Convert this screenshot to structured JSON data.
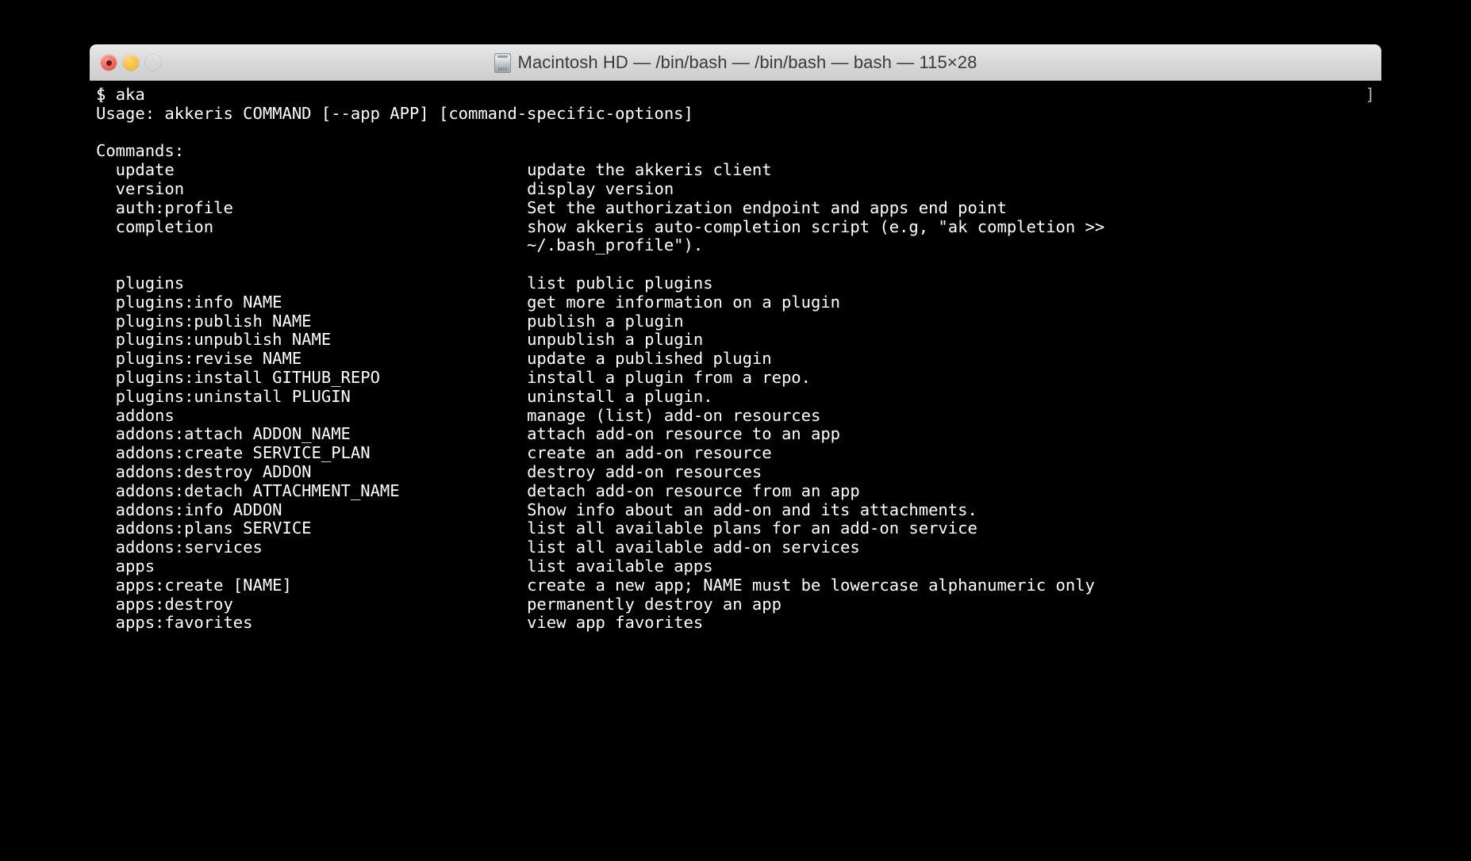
{
  "window": {
    "title": "Macintosh HD — /bin/bash — /bin/bash — bash — 115×28",
    "icon": "hard-disk-icon",
    "controls": {
      "close": "close",
      "minimize": "minimize",
      "zoom": "zoom"
    },
    "colors": {
      "background": "#000000",
      "foreground": "#ffffff",
      "titlebar": "#d8d8d8",
      "title_text": "#3a3a3a",
      "close": "#f2655a",
      "minimize": "#f7c13f",
      "zoom": "#5fc544"
    }
  },
  "terminal": {
    "edge_marker_left": "[",
    "edge_marker_right": "]",
    "prompt": "$ ",
    "command": "aka",
    "usage_line": "Usage: akkeris COMMAND [--app APP] [command-specific-options]",
    "commands_header": "Commands:",
    "column_gap_col": 44,
    "entries": [
      {
        "command": "update",
        "description": "update the akkeris client"
      },
      {
        "command": "version",
        "description": "display version"
      },
      {
        "command": "auth:profile",
        "description": "Set the authorization endpoint and apps end point"
      },
      {
        "command": "completion",
        "description": "show akkeris auto-completion script (e.g, \"ak completion >>",
        "description_cont": "~/.bash_profile\")."
      },
      {
        "command": "",
        "description": ""
      },
      {
        "command": "plugins",
        "description": "list public plugins"
      },
      {
        "command": "plugins:info NAME",
        "description": "get more information on a plugin"
      },
      {
        "command": "plugins:publish NAME",
        "description": "publish a plugin"
      },
      {
        "command": "plugins:unpublish NAME",
        "description": "unpublish a plugin"
      },
      {
        "command": "plugins:revise NAME",
        "description": "update a published plugin"
      },
      {
        "command": "plugins:install GITHUB_REPO",
        "description": "install a plugin from a repo."
      },
      {
        "command": "plugins:uninstall PLUGIN",
        "description": "uninstall a plugin."
      },
      {
        "command": "addons",
        "description": "manage (list) add-on resources"
      },
      {
        "command": "addons:attach ADDON_NAME",
        "description": "attach add-on resource to an app"
      },
      {
        "command": "addons:create SERVICE_PLAN",
        "description": "create an add-on resource"
      },
      {
        "command": "addons:destroy ADDON",
        "description": "destroy add-on resources"
      },
      {
        "command": "addons:detach ATTACHMENT_NAME",
        "description": "detach add-on resource from an app"
      },
      {
        "command": "addons:info ADDON",
        "description": "Show info about an add-on and its attachments."
      },
      {
        "command": "addons:plans SERVICE",
        "description": "list all available plans for an add-on service"
      },
      {
        "command": "addons:services",
        "description": "list all available add-on services"
      },
      {
        "command": "apps",
        "description": "list available apps"
      },
      {
        "command": "apps:create [NAME]",
        "description": "create a new app; NAME must be lowercase alphanumeric only"
      },
      {
        "command": "apps:destroy",
        "description": "permanently destroy an app"
      },
      {
        "command": "apps:favorites",
        "description": "view app favorites"
      }
    ]
  }
}
